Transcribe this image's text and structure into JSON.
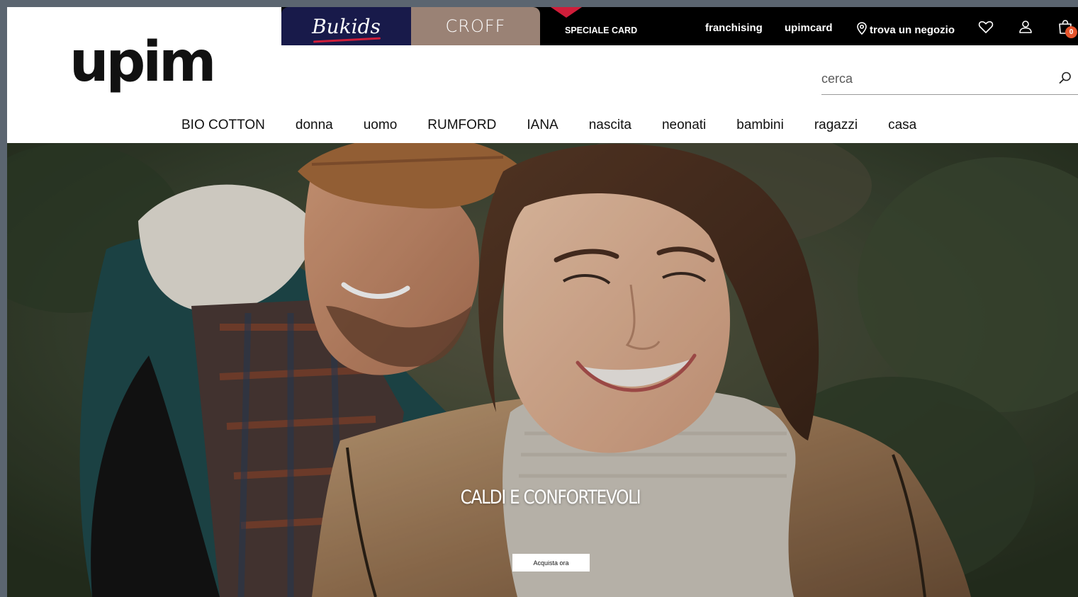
{
  "logo": {
    "text": "upim"
  },
  "brand_tabs": {
    "bukids": "Bukids",
    "croff": "CROFF"
  },
  "topbar": {
    "speciale_card": "SPECIALE CARD",
    "franchising": "franchising",
    "upimcard": "upimcard",
    "trova": "trova un negozio",
    "cart_count": "0"
  },
  "icons": {
    "location": "location-pin-icon",
    "wishlist": "heart-icon",
    "account": "user-icon",
    "cart": "shopping-bag-icon",
    "search": "search-icon"
  },
  "search": {
    "placeholder": "cerca"
  },
  "nav": {
    "items": [
      "BIO COTTON",
      "donna",
      "uomo",
      "RUMFORD",
      "IANA",
      "nascita",
      "neonati",
      "bambini",
      "ragazzi",
      "casa"
    ]
  },
  "hero": {
    "title": "CALDI E CONFORTEVOLI",
    "cta": "Acquista ora"
  },
  "colors": {
    "topbar": "#000000",
    "bukids_bg": "#181a4a",
    "croff_bg": "#9a8275",
    "accent_red": "#d01e3a",
    "badge": "#e5542c"
  }
}
